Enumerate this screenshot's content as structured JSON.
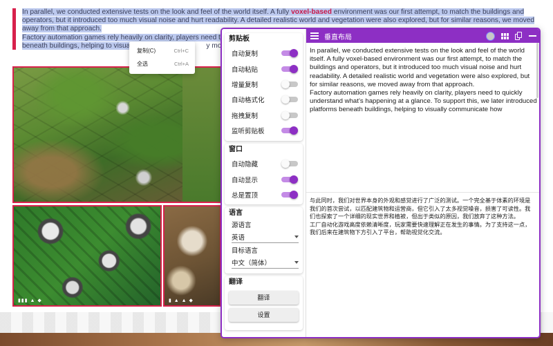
{
  "article": {
    "para1_selected": "In parallel, we conducted extensive tests on the look and feel of the world itself. A fully ",
    "para1_highlight": "voxel-based",
    "para1_rest": " environment was our first attempt, to match the buildings and operators, but it introduced too much visual noise and hurt readability. A detailed realistic world and vegetation were also explored, but for similar reasons, we moved away from that approach.",
    "para2_start": "Factory automation games rely heavily on clarity, players need t",
    "para2_line2_start": "beneath buildings, helping to visua",
    "para2_line2_end": "y module"
  },
  "context_menu": {
    "items": [
      {
        "label": "复制(C)",
        "shortcut": "Ctrl+C"
      },
      {
        "label": "全选",
        "shortcut": "Ctrl+A"
      }
    ]
  },
  "settings": {
    "clipboard": {
      "title": "剪贴板",
      "toggles": [
        {
          "label": "自动复制",
          "on": true
        },
        {
          "label": "自动粘贴",
          "on": true
        },
        {
          "label": "增量复制",
          "on": false
        },
        {
          "label": "自动格式化",
          "on": false
        },
        {
          "label": "拖拽复制",
          "on": false
        },
        {
          "label": "监听剪贴板",
          "on": true
        }
      ]
    },
    "window": {
      "title": "窗口",
      "toggles": [
        {
          "label": "自动隐藏",
          "on": false
        },
        {
          "label": "自动显示",
          "on": true
        },
        {
          "label": "总是置顶",
          "on": true
        }
      ]
    },
    "language": {
      "title": "语言",
      "source_label": "源语言",
      "source_value": "英语",
      "target_label": "目标语言",
      "target_value": "中文（简体）"
    },
    "translate": {
      "title": "翻译",
      "translate_button": "翻译",
      "settings_button": "设置"
    }
  },
  "header": {
    "title": "垂直布局"
  },
  "source_text": "In parallel, we conducted extensive tests on the look and feel of the world itself. A fully voxel-based environment was our first attempt, to match the buildings and  operators, but it introduced too much visual noise and hurt readability. A detailed realistic world and vegetation were also explored, but for similar reasons, we moved  away from that approach.\nFactory automation games rely heavily on clarity, players need to quickly understand what’s happening at a glance. To support this, we later introduced platforms  beneath buildings, helping to visually communicate how",
  "target_text": "与此同时，我们对世界本身的外观和感觉进行了广泛的测试。一个完全基于体素的环境是我们的首次尝试，以匹配建筑物和运营商，但它引入了太多视觉噪音，损害了可读性。我们也探索了一个详细的现实世界和植被，但出于类似的原因，我们放弃了这种方法。\n工厂自动化游戏高度依赖清晰度，玩家需要快速理解正在发生的事情。为了支持这一点，我们后来在建筑物下方引入了平台，帮助视觉化交流。",
  "colors": {
    "accent": "#8d2fc4",
    "highlight": "#c9184a",
    "selection": "#bcc9ee"
  }
}
